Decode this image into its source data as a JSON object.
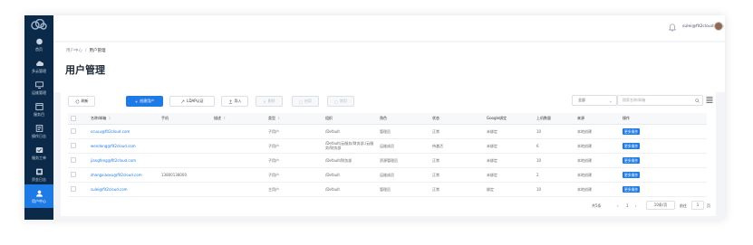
{
  "sidebar": {
    "items": [
      {
        "label": "首页",
        "icon": "dashboard-icon"
      },
      {
        "label": "多云管理",
        "icon": "cloud-icon"
      },
      {
        "label": "运维管理",
        "icon": "monitor-icon"
      },
      {
        "label": "服务目",
        "icon": "catalog-icon"
      },
      {
        "label": "操作日志",
        "icon": "log-icon"
      },
      {
        "label": "服务工单",
        "icon": "ticket-icon"
      },
      {
        "label": "资金日志",
        "icon": "finance-icon"
      },
      {
        "label": "用户中心",
        "icon": "user-icon"
      }
    ],
    "active_index": 7,
    "bg_color": "#0b2a4a",
    "active_color": "#1e7be6"
  },
  "topbar": {
    "user_email": "sulei@fit2cloud.com"
  },
  "breadcrumb": {
    "parent": "用户中心",
    "current": "用户管理"
  },
  "page_title": "用户管理",
  "toolbar": {
    "refresh": "刷新",
    "create": "创建用户",
    "ldap": "LDAP认证",
    "import": "导入",
    "delete": "删除",
    "enable": "启用",
    "disable": "禁用"
  },
  "filter": {
    "select_value": "全部",
    "search_placeholder": "搜索名称/邮箱"
  },
  "table": {
    "columns": [
      "名称/邮箱",
      "手机",
      "描述",
      "类型",
      "组织",
      "角色",
      "状态",
      "Google绑定",
      "上机数量",
      "来源",
      "操作"
    ],
    "sortable": [
      true,
      false,
      true,
      true,
      false,
      false,
      false,
      false,
      false,
      false,
      false
    ],
    "rows": [
      {
        "email": "ccuuu@fit2cloud.com",
        "phone": "",
        "desc": "",
        "type": "子用户",
        "org": "/Default",
        "role": "管理员",
        "status": "正常",
        "google": "未绑定",
        "count": "10",
        "source": "本地创建",
        "action": "更多操作"
      },
      {
        "email": "wendong@fit2cloud.com",
        "phone": "",
        "desc": "",
        "type": "子用户",
        "org": "/Default/云服务/财务部,/云服务/财务部",
        "role": "运维成员",
        "status": "待激活",
        "google": "未绑定",
        "count": "6",
        "source": "本地创建",
        "action": "更多操作"
      },
      {
        "email": "jiangfeng@fit2cloud.com",
        "phone": "",
        "desc": "",
        "type": "子用户",
        "org": "/Default/财务部",
        "role": "资源管理员",
        "status": "正常",
        "google": "未绑定",
        "count": "10",
        "source": "本地创建",
        "action": "更多操作"
      },
      {
        "email": "zhangxiaoxu@fit2cloud.com",
        "phone": "13800138000",
        "desc": "",
        "type": "子用户",
        "org": "/Default",
        "role": "运维成员",
        "status": "正常",
        "google": "未绑定",
        "count": "2",
        "source": "本地创建",
        "action": "更多操作"
      },
      {
        "email": "sulei@fit2cloud.com",
        "phone": "",
        "desc": "",
        "type": "主用户",
        "org": "/Default",
        "role": "管理员",
        "status": "正常",
        "google": "绑定",
        "count": "10",
        "source": "本地创建",
        "action": "更多操作"
      }
    ]
  },
  "pagination": {
    "total": "共5条",
    "prev": "‹",
    "page": "1",
    "next": "›",
    "page_size": "10条/页",
    "goto_label": "前往",
    "goto_value": "1",
    "goto_suffix": "页"
  }
}
